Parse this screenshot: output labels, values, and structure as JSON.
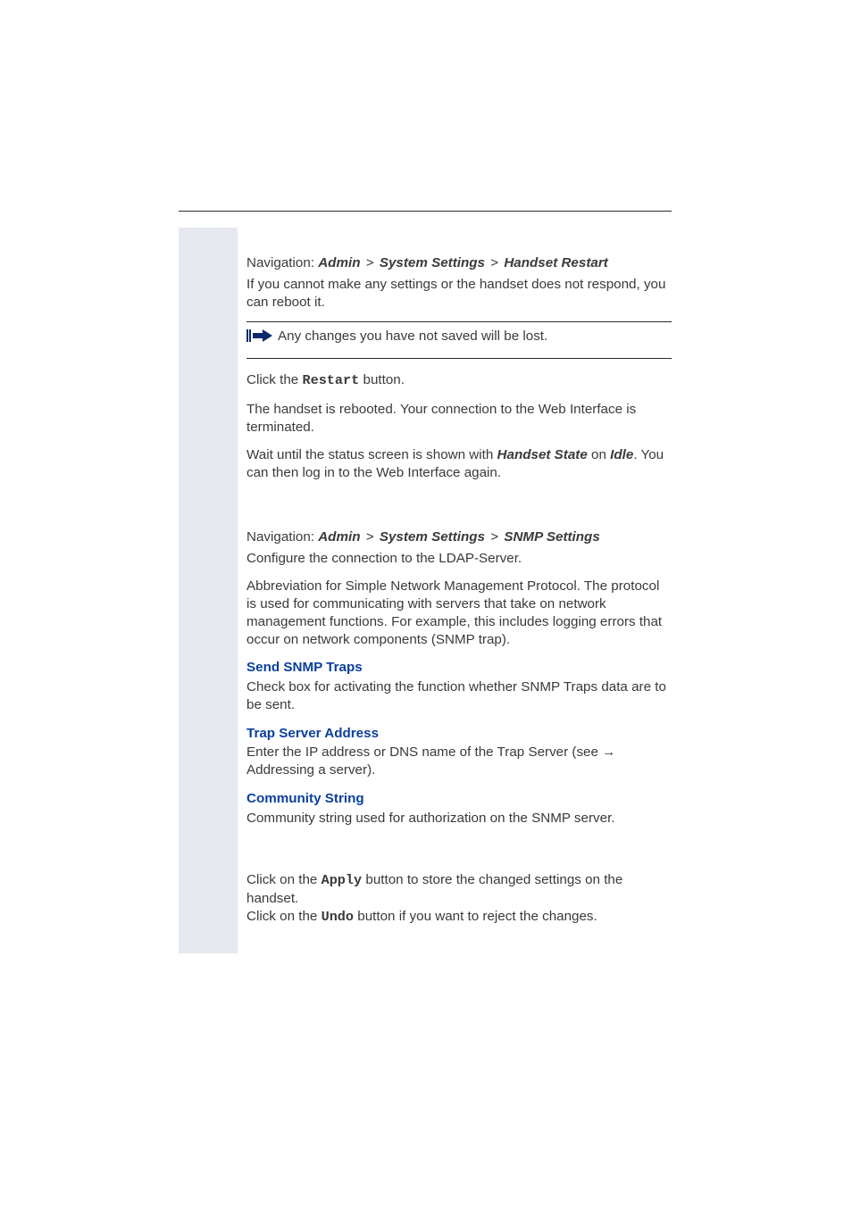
{
  "section1": {
    "nav_label": "Navigation:",
    "nav_parts": [
      "Admin",
      "System Settings",
      "Handset Restart"
    ],
    "sep": ">",
    "intro": "If you cannot make any settings or the handset does not respond, you can reboot it.",
    "note": "Any changes you have not saved will be lost.",
    "click_prefix": "Click the ",
    "click_button": "Restart",
    "click_suffix": " button.",
    "rebooted": "The handset is rebooted. Your connection to the Web Interface is terminated.",
    "wait_prefix": "Wait until the status screen is shown with ",
    "wait_state": "Handset State",
    "wait_mid": " on ",
    "wait_idle": "Idle",
    "wait_suffix": ". You can then log in to the Web Interface again."
  },
  "section2": {
    "nav_label": "Navigation:",
    "nav_parts": [
      "Admin",
      "System Settings",
      "SNMP Settings"
    ],
    "sep": ">",
    "configure": "Configure the connection to the LDAP-Server.",
    "abbrev": "Abbreviation for Simple Network Management Protocol. The protocol is used for communicating with servers that take on network management functions. For example, this includes logging errors that occur on network components (SNMP trap).",
    "h_send": "Send SNMP Traps",
    "p_send": "Check box for activating the function whether SNMP Traps data are to be sent.",
    "h_trap": "Trap Server Address",
    "p_trap_prefix": "Enter the IP address or DNS name of the Trap Server (see ",
    "p_trap_arrow": "→",
    "p_trap_suffix": " Addressing a server).",
    "h_comm": "Community String",
    "p_comm": "Community string used for authorization on the SNMP server.",
    "apply_prefix": "Click on the ",
    "apply_btn": "Apply",
    "apply_suffix": " button to store the changed settings on the handset.",
    "undo_prefix": "Click on the ",
    "undo_btn": "Undo",
    "undo_suffix": " button if you want to reject the changes."
  }
}
